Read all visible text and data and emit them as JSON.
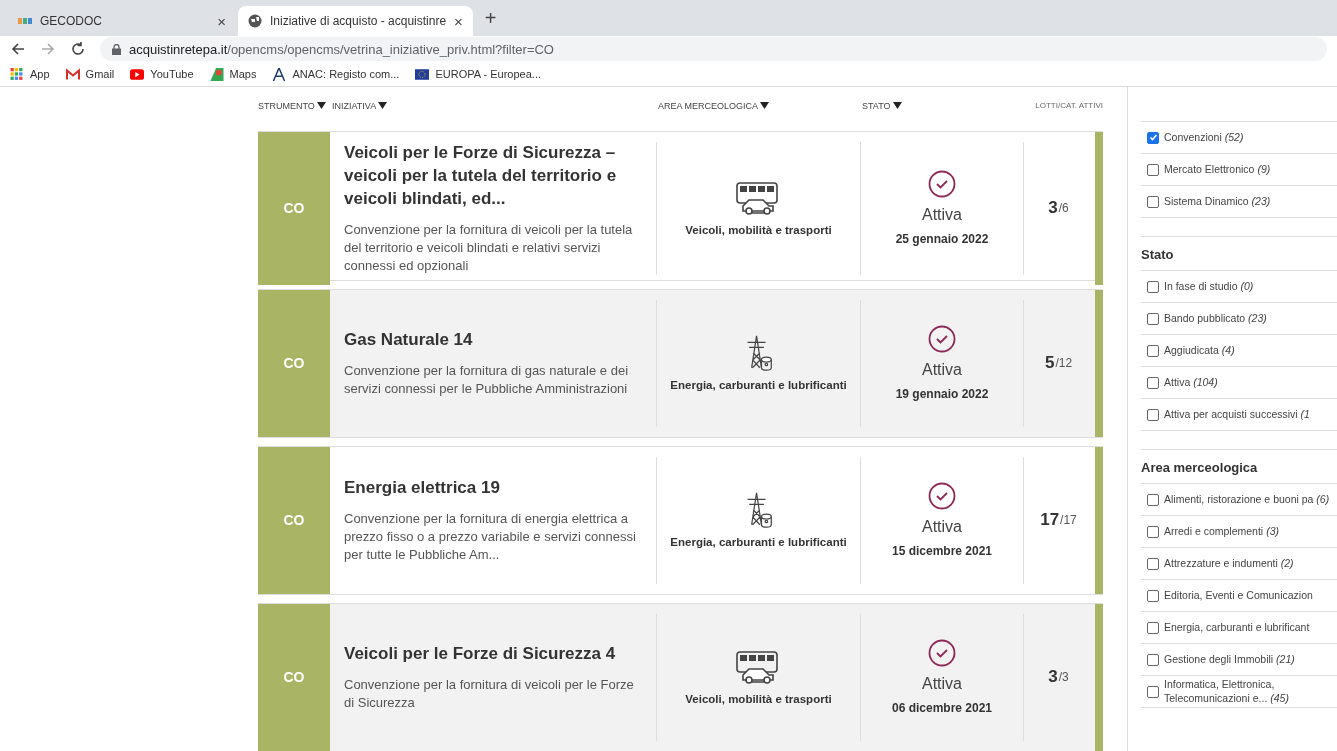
{
  "browser": {
    "tabs": [
      {
        "title": "GECODOC",
        "selected": false,
        "close": "×"
      },
      {
        "title": "Iniziative di acquisto - acquistinre",
        "selected": true,
        "close": "×"
      }
    ],
    "new_tab": "+",
    "url_host": "acquistinretepa.it",
    "url_path": "/opencms/opencms/vetrina_iniziative_priv.html?filter=CO",
    "bookmarks": [
      {
        "label": "App",
        "kind": "apps"
      },
      {
        "label": "Gmail",
        "kind": "gmail"
      },
      {
        "label": "YouTube",
        "kind": "youtube"
      },
      {
        "label": "Maps",
        "kind": "maps"
      },
      {
        "label": "ANAC: Registo com...",
        "kind": "anac"
      },
      {
        "label": "EUROPA - Europea...",
        "kind": "europa"
      }
    ]
  },
  "table": {
    "columns": [
      {
        "label": "STRUMENTO",
        "sortable": true
      },
      {
        "label": "INIZIATIVA",
        "sortable": true
      },
      {
        "label": "AREA MERCEOLOGICA",
        "sortable": true
      },
      {
        "label": "STATO",
        "sortable": true
      },
      {
        "label": "LOTTI/CAT. ATTIVI",
        "sortable": false
      }
    ],
    "rows": [
      {
        "instrument": "CO",
        "title": "Veicoli per le Forze di Sicurezza – veicoli per la tutela del territorio e veicoli blindati, ed...",
        "description": "Convenzione per la fornitura di veicoli per la tutela del territorio e veicoli blindati e relativi servizi connessi ed opzionali",
        "area": "Veicoli, mobilità e trasporti",
        "kind": "vehicles",
        "status": "Attiva",
        "date": "25 gennaio 2022",
        "lots_active": "3",
        "lots_total": "/6"
      },
      {
        "instrument": "CO",
        "title": "Gas Naturale 14",
        "description": "Convenzione per la fornitura di gas naturale e dei servizi connessi per le Pubbliche Amministrazioni",
        "area": "Energia, carburanti e lubrificanti",
        "kind": "energy",
        "status": "Attiva",
        "date": "19 gennaio 2022",
        "lots_active": "5",
        "lots_total": "/12"
      },
      {
        "instrument": "CO",
        "title": "Energia elettrica 19",
        "description": "Convenzione per la fornitura di energia elettrica a prezzo fisso o a prezzo variabile e servizi connessi per tutte le Pubbliche Am...",
        "area": "Energia, carburanti e lubrificanti",
        "kind": "energy",
        "status": "Attiva",
        "date": "15 dicembre 2021",
        "lots_active": "17",
        "lots_total": "/17"
      },
      {
        "instrument": "CO",
        "title": "Veicoli per le Forze di Sicurezza 4",
        "description": "Convenzione per la fornitura di veicoli per le Forze di Sicurezza",
        "area": "Veicoli, mobilità e trasporti",
        "kind": "vehicles",
        "status": "Attiva",
        "date": "06 dicembre 2021",
        "lots_active": "3",
        "lots_total": "/3"
      }
    ]
  },
  "filters": [
    {
      "items": [
        {
          "label": "Convenzioni",
          "count": "(52)",
          "checked": true
        },
        {
          "label": "Mercato Elettronico",
          "count": "(9)",
          "checked": false
        },
        {
          "label": "Sistema Dinamico",
          "count": "(23)",
          "checked": false
        }
      ]
    },
    {
      "title": "Stato",
      "items": [
        {
          "label": "In fase di studio",
          "count": "(0)",
          "checked": false
        },
        {
          "label": "Bando pubblicato",
          "count": "(23)",
          "checked": false
        },
        {
          "label": "Aggiudicata",
          "count": "(4)",
          "checked": false
        },
        {
          "label": "Attiva",
          "count": "(104)",
          "checked": false
        },
        {
          "label": "Attiva per acquisti successivi",
          "count": "(1",
          "checked": false
        }
      ]
    },
    {
      "title": "Area merceologica",
      "items": [
        {
          "label": "Alimenti, ristorazione e buoni pa",
          "count": "(6)",
          "checked": false
        },
        {
          "label": "Arredi e complementi",
          "count": "(3)",
          "checked": false
        },
        {
          "label": "Attrezzature e indumenti",
          "count": "(2)",
          "checked": false
        },
        {
          "label": "Editoria, Eventi e Comunicazion",
          "checked": false
        },
        {
          "label": "Energia, carburanti e lubrificant",
          "checked": false
        },
        {
          "label": "Gestione degli Immobili",
          "count": "(21)",
          "checked": false
        },
        {
          "label": "Informatica, Elettronica, Telecomunicazioni e...",
          "count": "(45)",
          "checked": false
        }
      ]
    }
  ]
}
